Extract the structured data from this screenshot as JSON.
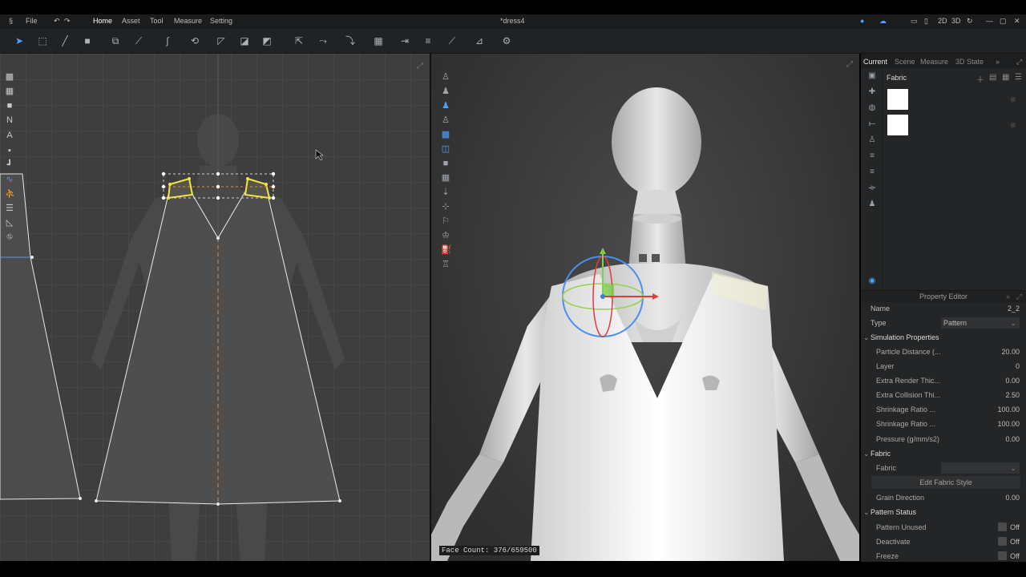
{
  "menu": {
    "file": "File",
    "home": "Home",
    "asset": "Asset",
    "tool": "Tool",
    "measure": "Measure",
    "setting": "Setting",
    "doc_title": "*dress4",
    "view_2d": "2D",
    "view_3d": "3D"
  },
  "right_tabs": {
    "current": "Current",
    "scene": "Scene",
    "measure": "Measure",
    "state": "3D State"
  },
  "fabric_panel": {
    "title": "Fabric"
  },
  "property_editor": {
    "title": "Property Editor",
    "name_label": "Name",
    "name_value": "2_2",
    "type_label": "Type",
    "type_value": "Pattern",
    "sim_section": "Simulation Properties",
    "particle_label": "Particle Distance (...",
    "particle_value": "20.00",
    "layer_label": "Layer",
    "layer_value": "0",
    "extra_render_label": "Extra Render Thic...",
    "extra_render_value": "0.00",
    "extra_collision_label": "Extra Collision Thi...",
    "extra_collision_value": "2.50",
    "shrink1_label": "Shrinkage Ratio ...",
    "shrink1_value": "100.00",
    "shrink2_label": "Shrinkage Ratio ...",
    "shrink2_value": "100.00",
    "pressure_label": "Pressure (g/mm/s2)",
    "pressure_value": "0.00",
    "fabric_section": "Fabric",
    "fabric_label": "Fabric",
    "edit_style": "Edit Fabric Style",
    "grain_label": "Grain Direction",
    "grain_value": "0.00",
    "status_section": "Pattern Status",
    "unused_label": "Pattern Unused",
    "unused_value": "Off",
    "deactivate_label": "Deactivate",
    "deactivate_value": "Off",
    "freeze_label": "Freeze",
    "freeze_value": "Off"
  },
  "viewport": {
    "face_count": "Face Count: 376/659500"
  },
  "colors": {
    "accent": "#4aa3ff",
    "selection": "#f3e24a",
    "center_line": "#e7893a"
  }
}
